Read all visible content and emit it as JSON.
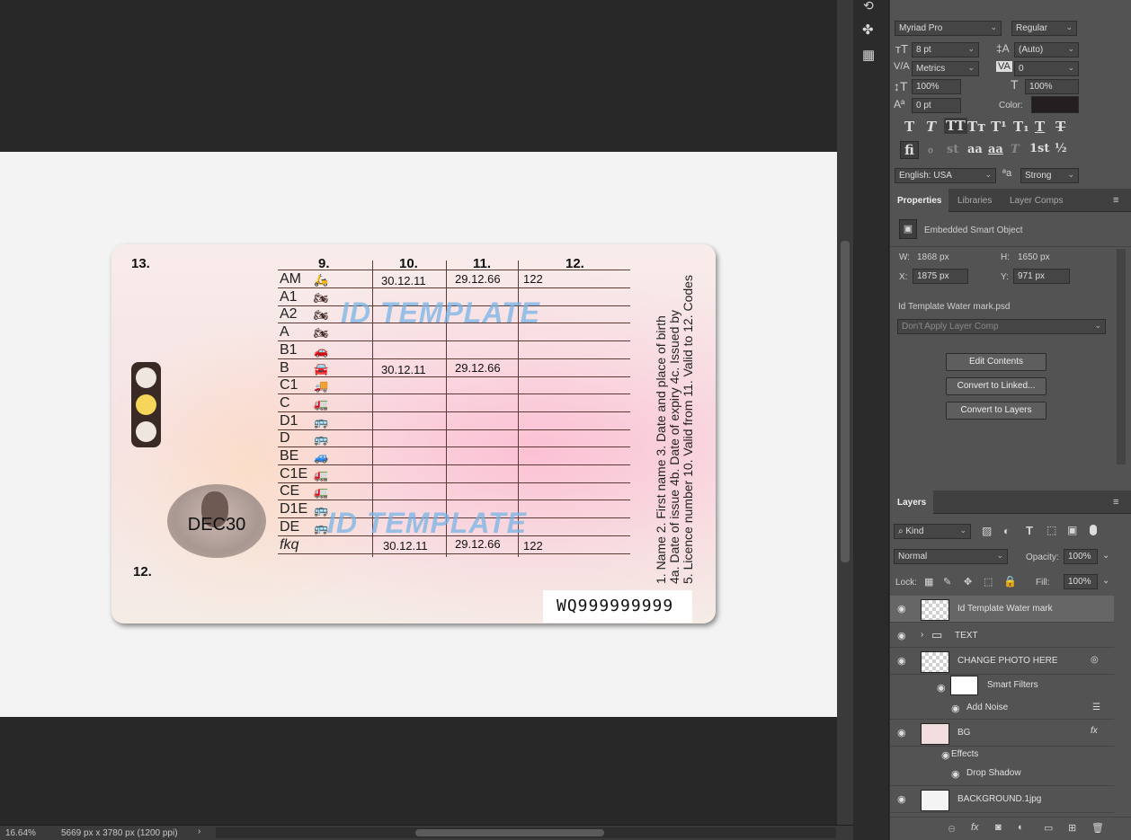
{
  "canvas": {
    "card": {
      "num13": "13.",
      "num12": "12.",
      "col9": "9.",
      "col10": "10.",
      "col11": "11.",
      "col12": "12.",
      "photo_text": "DEC30",
      "categories": [
        "AM",
        "A1",
        "A2",
        "A",
        "B1",
        "B",
        "C1",
        "C",
        "D1",
        "D",
        "BE",
        "C1E",
        "CE",
        "D1E",
        "DE",
        "fkq"
      ],
      "rows": [
        {
          "c10": "30.12.11",
          "c11": "29.12.66",
          "c12": "122"
        },
        {
          "c10": "30.12.11",
          "c11": "29.12.66",
          "c12": ""
        },
        {
          "c10": "30.12.11",
          "c11": "29.12.66",
          "c12": "122"
        }
      ],
      "watermark": "ID TEMPLATE",
      "vertical_line1": "1. Name  2. First name  3. Date and place of birth",
      "vertical_line2": "4a. Date of issue  4b. Date of expiry  4c. Issued by",
      "vertical_line3": "5. Licence number  10. Valid from  11. Valid to  12. Codes",
      "licence_number": "WQ999999999"
    }
  },
  "status": {
    "zoom": "16.64%",
    "doc_info": "5669 px x 3780 px (1200 ppi)"
  },
  "character": {
    "font_family": "Myriad Pro",
    "font_style": "Regular",
    "size": "8 pt",
    "leading": "(Auto)",
    "kerning": "Metrics",
    "tracking": "0",
    "vscale": "100%",
    "hscale": "100%",
    "baseline": "0 pt",
    "color_label": "Color:",
    "language": "English: USA",
    "antialias": "Strong",
    "aa_label": "ªa"
  },
  "properties": {
    "tabs": [
      "Properties",
      "Libraries",
      "Layer Comps"
    ],
    "type": "Embedded Smart Object",
    "w_label": "W:",
    "w": "1868 px",
    "h_label": "H:",
    "h": "1650 px",
    "x_label": "X:",
    "x": "1875 px",
    "y_label": "Y:",
    "y": "971 px",
    "file": "Id Templat‍e Water mark.psd",
    "layer_comp": "Don't Apply Layer Comp",
    "buttons": [
      "Edit Contents",
      "Convert to Linked...",
      "Convert to Layers"
    ]
  },
  "layers": {
    "tab": "Layers",
    "kind": "Kind",
    "blend": "Normal",
    "opacity_label": "Opacity:",
    "opacity": "100%",
    "lock_label": "Lock:",
    "fill_label": "Fill:",
    "fill": "100%",
    "items": {
      "watermark": "Id Template Water mark",
      "text": "TEXT",
      "photo": "CHANGE PHOTO HERE",
      "smart_filters": "Smart Filters",
      "add_noise": "Add Noise",
      "bg": "BG",
      "effects": "Effects",
      "drop_shadow": "Drop Shadow",
      "background": "BACKGROUND.1jpg"
    }
  },
  "colors": {
    "accent_yellow": "#f5d55a",
    "watermark_blue": "#78b4e6",
    "panel": "#535353"
  }
}
